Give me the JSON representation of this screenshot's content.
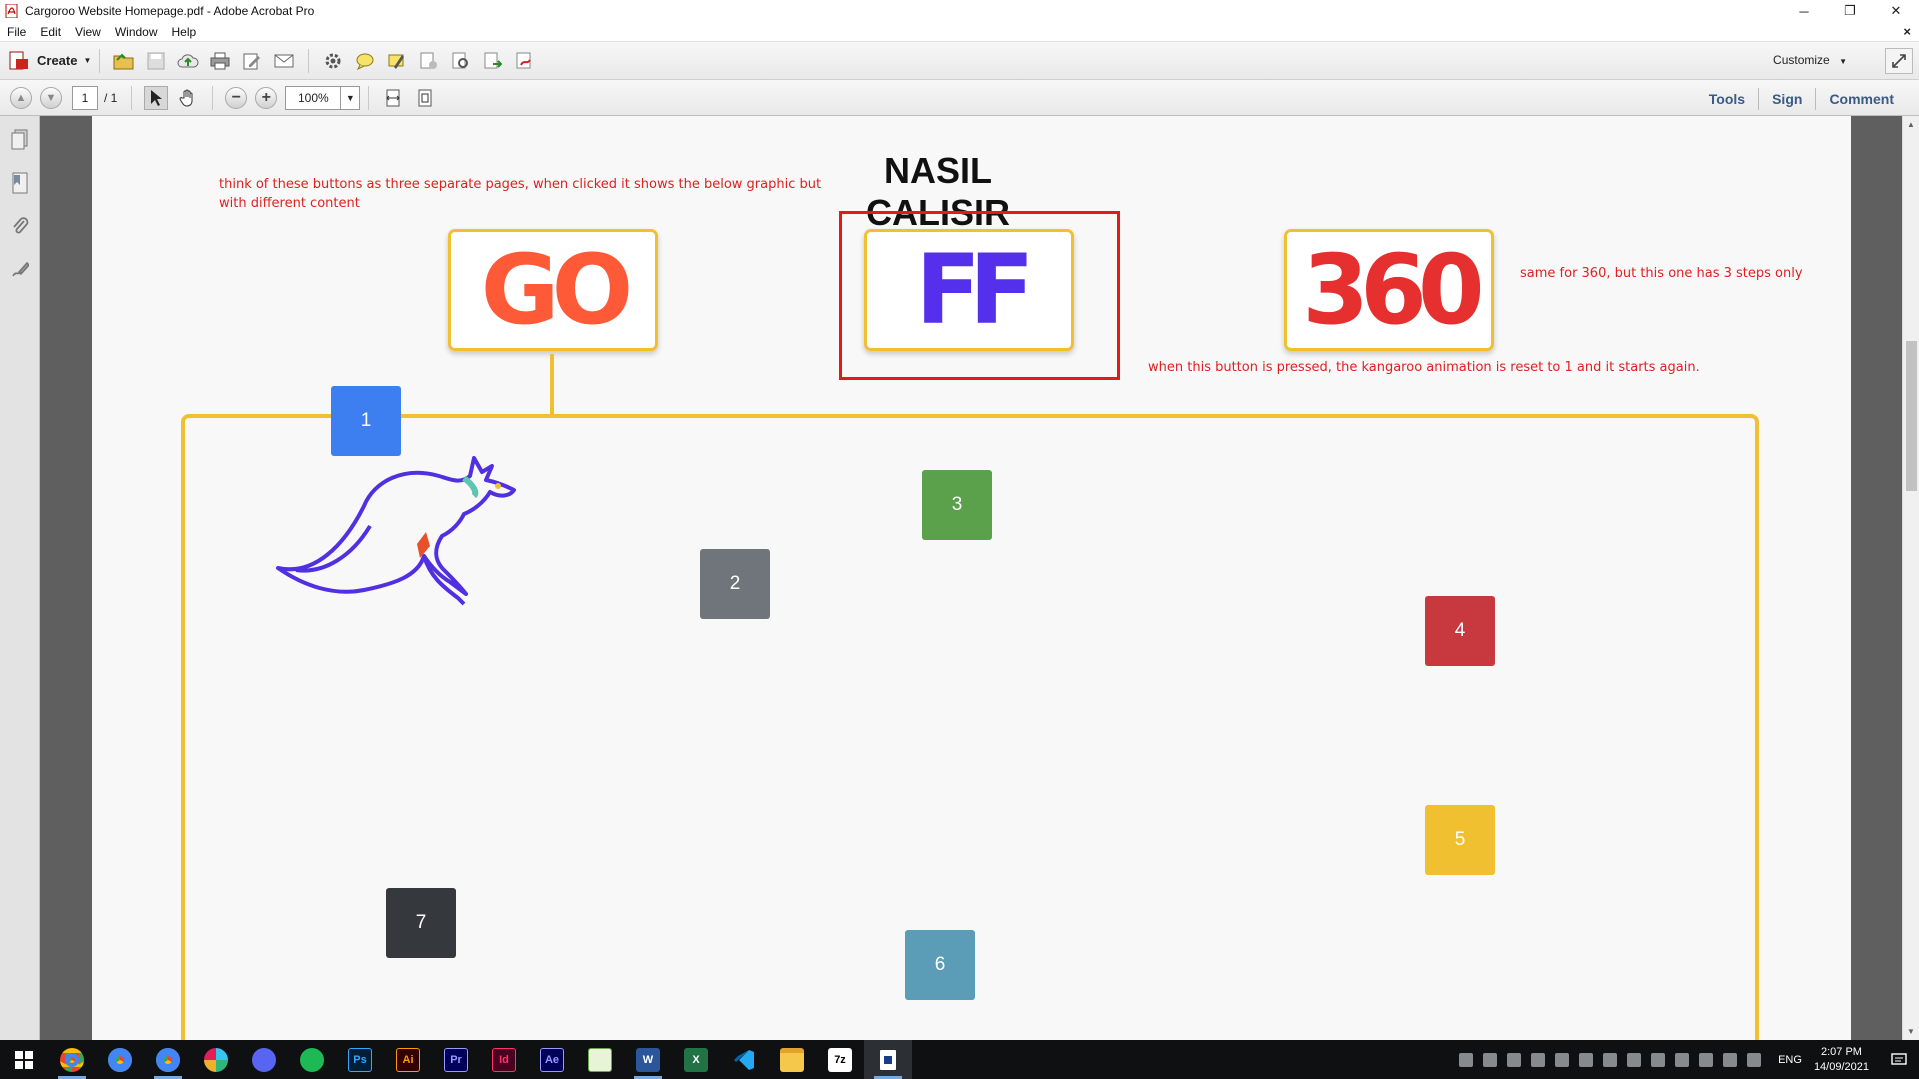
{
  "window": {
    "title": "Cargoroo Website Homepage.pdf - Adobe Acrobat Pro",
    "minimize": "─",
    "restore": "❐",
    "close": "✕"
  },
  "menu": {
    "items": [
      "File",
      "Edit",
      "View",
      "Window",
      "Help"
    ],
    "close_doc": "×"
  },
  "toolbar": {
    "create_label": "Create",
    "customize_label": "Customize"
  },
  "nav": {
    "page_current": "1",
    "page_total": "/ 1",
    "zoom": "100%",
    "tools_label": "Tools",
    "sign_label": "Sign",
    "comment_label": "Comment"
  },
  "document": {
    "heading": "NASIL CALISIR",
    "note_top": "think of these buttons as three separate pages, when clicked it shows the below graphic but with different content",
    "note_360": "same for 360, but this one has 3 steps only",
    "note_ff": "when this button is pressed, the kangaroo animation is reset to 1 and it starts again.",
    "buttons": {
      "go": "GO",
      "ff": "FF",
      "t360": "360"
    },
    "steps": [
      {
        "label": "1",
        "color": "#3d7ff0"
      },
      {
        "label": "2",
        "color": "#6f757b"
      },
      {
        "label": "3",
        "color": "#5ba04a"
      },
      {
        "label": "4",
        "color": "#c7393f"
      },
      {
        "label": "5",
        "color": "#f0c030"
      },
      {
        "label": "6",
        "color": "#5b9cb6"
      },
      {
        "label": "7",
        "color": "#35383d"
      }
    ],
    "colors": {
      "accent_yellow": "#f0c030",
      "note_red": "#e02020",
      "go_orange": "#ff5a38",
      "ff_purple": "#5530ec",
      "t360_red": "#e63030",
      "kangaroo_stroke": "#5030e0"
    }
  },
  "taskbar": {
    "apps": [
      {
        "name": "start-icon"
      },
      {
        "name": "chrome-icon"
      },
      {
        "name": "chrome-icon"
      },
      {
        "name": "chrome-icon"
      },
      {
        "name": "slack-icon"
      },
      {
        "name": "discord-icon"
      },
      {
        "name": "spotify-icon"
      },
      {
        "name": "photoshop-icon",
        "label": "Ps"
      },
      {
        "name": "illustrator-icon",
        "label": "Ai"
      },
      {
        "name": "premiere-icon",
        "label": "Pr"
      },
      {
        "name": "indesign-icon",
        "label": "Id"
      },
      {
        "name": "after-effects-icon",
        "label": "Ae"
      },
      {
        "name": "notepad-icon"
      },
      {
        "name": "word-icon",
        "label": "W"
      },
      {
        "name": "excel-icon",
        "label": "X"
      },
      {
        "name": "vscode-icon"
      },
      {
        "name": "file-explorer-icon"
      },
      {
        "name": "7zip-icon",
        "label": "7z"
      },
      {
        "name": "acrobat-icon"
      }
    ],
    "language": "ENG",
    "time": "2:07 PM",
    "date": "14/09/2021"
  }
}
